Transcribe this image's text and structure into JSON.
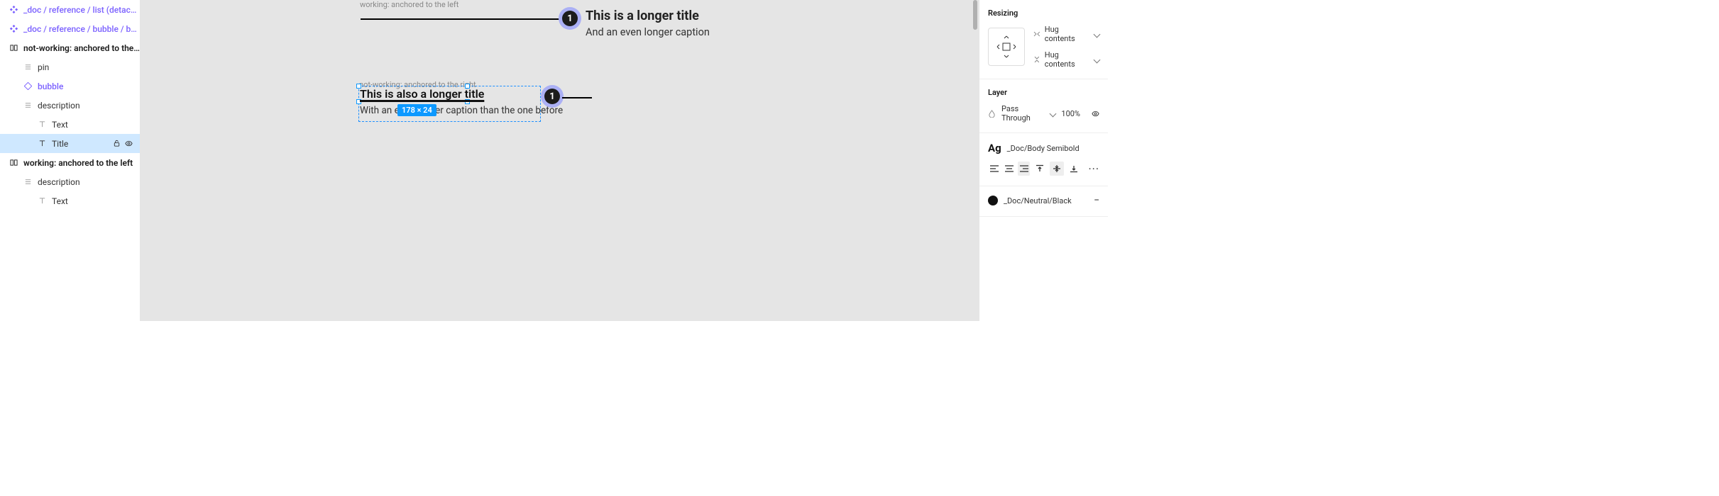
{
  "layers": {
    "comp_ref_list": "_doc / reference / list  (detach to …",
    "comp_ref_bubble": "_doc / reference / bubble / base",
    "frame_notworking": "not-working: anchored to the right",
    "pin": "pin",
    "bubble": "bubble",
    "description": "description",
    "text": "Text",
    "title": "Title",
    "frame_working": "working: anchored to the left",
    "description2": "description",
    "text2": "Text"
  },
  "canvas": {
    "f1": {
      "label": "working: anchored to the left",
      "bubble": "1",
      "title": "This is a longer title",
      "caption": "And an even longer caption"
    },
    "f2": {
      "label": "not-working: anchored to the right",
      "bubble": "1",
      "title": "This is also a longer title",
      "caption": "With an even longer caption than the one before",
      "size": "178 × 24"
    }
  },
  "inspect": {
    "resizing": {
      "title": "Resizing",
      "h": "Hug contents",
      "v": "Hug contents"
    },
    "layer": {
      "title": "Layer",
      "blend": "Pass Through",
      "opacity": "100%"
    },
    "text": {
      "style": "_Doc/Body Semibold",
      "ag": "Ag"
    },
    "fill": {
      "name": "_Doc/Neutral/Black"
    }
  }
}
